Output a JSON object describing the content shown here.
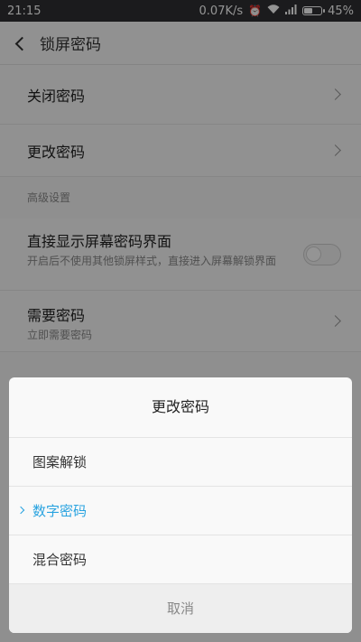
{
  "status_bar": {
    "time": "21:15",
    "speed": "0.07K/s",
    "battery": "45%",
    "battery_level": 0.45
  },
  "header": {
    "title": "锁屏密码"
  },
  "settings": {
    "close_password": "关闭密码",
    "change_password": "更改密码",
    "advanced_header": "高级设置",
    "show_lock_screen": {
      "label": "直接显示屏幕密码界面",
      "sub": "开启后不使用其他锁屏样式，直接进入屏幕解锁界面",
      "enabled": false
    },
    "require_password": {
      "label": "需要密码",
      "sub": "立即需要密码"
    }
  },
  "dialog": {
    "title": "更改密码",
    "options": [
      "图案解锁",
      "数字密码",
      "混合密码"
    ],
    "selected": "数字密码",
    "cancel": "取消"
  },
  "colors": {
    "accent": "#29a3e0",
    "status_bar": "#2f3033"
  },
  "icons": [
    "alarm-icon",
    "wifi-icon",
    "signal-icon",
    "battery-icon",
    "back-icon",
    "chevron-right-icon"
  ]
}
